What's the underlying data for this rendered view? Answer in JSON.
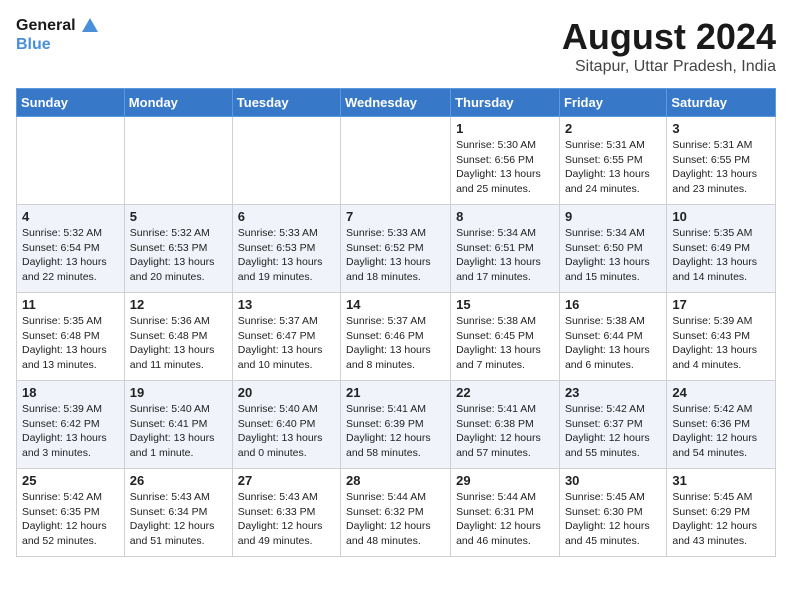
{
  "logo": {
    "line1": "General",
    "line2": "Blue"
  },
  "title": "August 2024",
  "location": "Sitapur, Uttar Pradesh, India",
  "days_of_week": [
    "Sunday",
    "Monday",
    "Tuesday",
    "Wednesday",
    "Thursday",
    "Friday",
    "Saturday"
  ],
  "weeks": [
    [
      {
        "day": "",
        "content": ""
      },
      {
        "day": "",
        "content": ""
      },
      {
        "day": "",
        "content": ""
      },
      {
        "day": "",
        "content": ""
      },
      {
        "day": "1",
        "content": "Sunrise: 5:30 AM\nSunset: 6:56 PM\nDaylight: 13 hours\nand 25 minutes."
      },
      {
        "day": "2",
        "content": "Sunrise: 5:31 AM\nSunset: 6:55 PM\nDaylight: 13 hours\nand 24 minutes."
      },
      {
        "day": "3",
        "content": "Sunrise: 5:31 AM\nSunset: 6:55 PM\nDaylight: 13 hours\nand 23 minutes."
      }
    ],
    [
      {
        "day": "4",
        "content": "Sunrise: 5:32 AM\nSunset: 6:54 PM\nDaylight: 13 hours\nand 22 minutes."
      },
      {
        "day": "5",
        "content": "Sunrise: 5:32 AM\nSunset: 6:53 PM\nDaylight: 13 hours\nand 20 minutes."
      },
      {
        "day": "6",
        "content": "Sunrise: 5:33 AM\nSunset: 6:53 PM\nDaylight: 13 hours\nand 19 minutes."
      },
      {
        "day": "7",
        "content": "Sunrise: 5:33 AM\nSunset: 6:52 PM\nDaylight: 13 hours\nand 18 minutes."
      },
      {
        "day": "8",
        "content": "Sunrise: 5:34 AM\nSunset: 6:51 PM\nDaylight: 13 hours\nand 17 minutes."
      },
      {
        "day": "9",
        "content": "Sunrise: 5:34 AM\nSunset: 6:50 PM\nDaylight: 13 hours\nand 15 minutes."
      },
      {
        "day": "10",
        "content": "Sunrise: 5:35 AM\nSunset: 6:49 PM\nDaylight: 13 hours\nand 14 minutes."
      }
    ],
    [
      {
        "day": "11",
        "content": "Sunrise: 5:35 AM\nSunset: 6:48 PM\nDaylight: 13 hours\nand 13 minutes."
      },
      {
        "day": "12",
        "content": "Sunrise: 5:36 AM\nSunset: 6:48 PM\nDaylight: 13 hours\nand 11 minutes."
      },
      {
        "day": "13",
        "content": "Sunrise: 5:37 AM\nSunset: 6:47 PM\nDaylight: 13 hours\nand 10 minutes."
      },
      {
        "day": "14",
        "content": "Sunrise: 5:37 AM\nSunset: 6:46 PM\nDaylight: 13 hours\nand 8 minutes."
      },
      {
        "day": "15",
        "content": "Sunrise: 5:38 AM\nSunset: 6:45 PM\nDaylight: 13 hours\nand 7 minutes."
      },
      {
        "day": "16",
        "content": "Sunrise: 5:38 AM\nSunset: 6:44 PM\nDaylight: 13 hours\nand 6 minutes."
      },
      {
        "day": "17",
        "content": "Sunrise: 5:39 AM\nSunset: 6:43 PM\nDaylight: 13 hours\nand 4 minutes."
      }
    ],
    [
      {
        "day": "18",
        "content": "Sunrise: 5:39 AM\nSunset: 6:42 PM\nDaylight: 13 hours\nand 3 minutes."
      },
      {
        "day": "19",
        "content": "Sunrise: 5:40 AM\nSunset: 6:41 PM\nDaylight: 13 hours\nand 1 minute."
      },
      {
        "day": "20",
        "content": "Sunrise: 5:40 AM\nSunset: 6:40 PM\nDaylight: 13 hours\nand 0 minutes."
      },
      {
        "day": "21",
        "content": "Sunrise: 5:41 AM\nSunset: 6:39 PM\nDaylight: 12 hours\nand 58 minutes."
      },
      {
        "day": "22",
        "content": "Sunrise: 5:41 AM\nSunset: 6:38 PM\nDaylight: 12 hours\nand 57 minutes."
      },
      {
        "day": "23",
        "content": "Sunrise: 5:42 AM\nSunset: 6:37 PM\nDaylight: 12 hours\nand 55 minutes."
      },
      {
        "day": "24",
        "content": "Sunrise: 5:42 AM\nSunset: 6:36 PM\nDaylight: 12 hours\nand 54 minutes."
      }
    ],
    [
      {
        "day": "25",
        "content": "Sunrise: 5:42 AM\nSunset: 6:35 PM\nDaylight: 12 hours\nand 52 minutes."
      },
      {
        "day": "26",
        "content": "Sunrise: 5:43 AM\nSunset: 6:34 PM\nDaylight: 12 hours\nand 51 minutes."
      },
      {
        "day": "27",
        "content": "Sunrise: 5:43 AM\nSunset: 6:33 PM\nDaylight: 12 hours\nand 49 minutes."
      },
      {
        "day": "28",
        "content": "Sunrise: 5:44 AM\nSunset: 6:32 PM\nDaylight: 12 hours\nand 48 minutes."
      },
      {
        "day": "29",
        "content": "Sunrise: 5:44 AM\nSunset: 6:31 PM\nDaylight: 12 hours\nand 46 minutes."
      },
      {
        "day": "30",
        "content": "Sunrise: 5:45 AM\nSunset: 6:30 PM\nDaylight: 12 hours\nand 45 minutes."
      },
      {
        "day": "31",
        "content": "Sunrise: 5:45 AM\nSunset: 6:29 PM\nDaylight: 12 hours\nand 43 minutes."
      }
    ]
  ]
}
